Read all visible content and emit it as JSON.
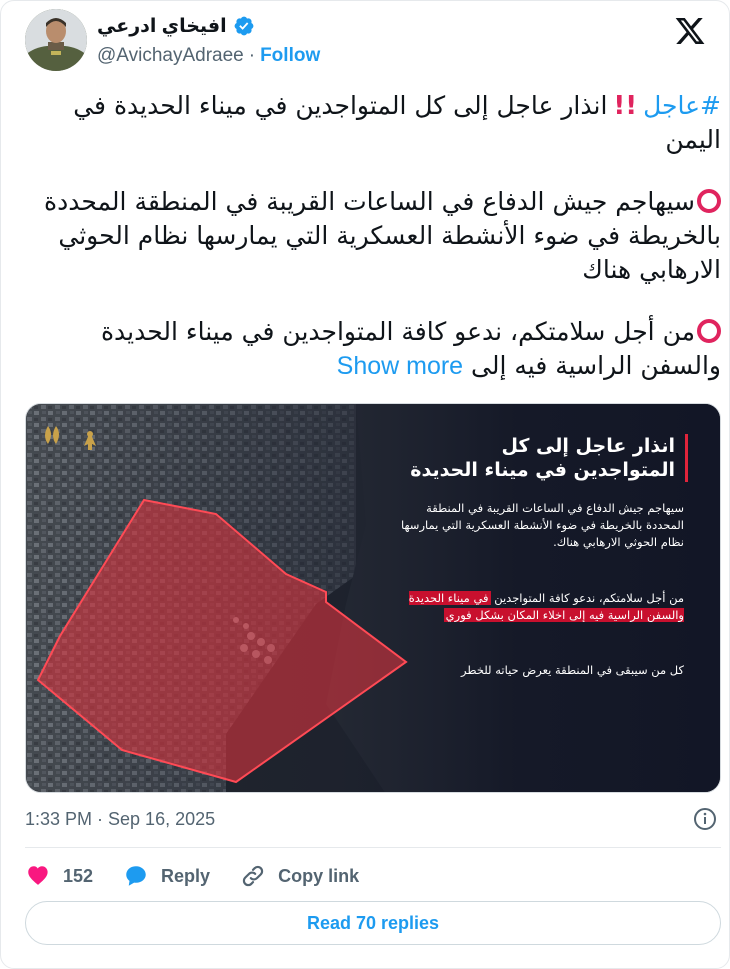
{
  "author": {
    "display_name": "افيخاي ادرعي",
    "handle": "@AvichayAdraee",
    "separator": "·",
    "follow_label": "Follow"
  },
  "tweet": {
    "hashtag": "#عاجل",
    "line1_rest": "انذار عاجل إلى كل المتواجدين في ميناء الحديدة في اليمن",
    "para2": "سيهاجم جيش الدفاع في الساعات القريبة في المنطقة المحددة بالخريطة في ضوء الأنشطة العسكرية التي يمارسها نظام الحوثي الارهابي هناك",
    "para3": "من أجل سلامتكم، ندعو كافة المتواجدين في ميناء الحديدة والسفن الراسية فيه إلى",
    "show_more": "Show more"
  },
  "media": {
    "title": "انذار عاجل إلى كل المتواجدين في ميناء الحديدة",
    "p1": "سيهاجم جيش الدفاع في الساعات القريبة في المنطقة المحددة بالخريطة في ضوء الأنشطة العسكرية التي يمارسها نظام الحوثي الارهابي هناك.",
    "p2_plain": "من أجل سلامتكم، ندعو كافة المتواجدين",
    "p2_highlight": "في ميناء الحديدة والسفن الراسية فيه إلى اخلاء المكان بشكل فوري",
    "p3": "كل من سيبقى في المنطقة يعرض حياته للخطر",
    "zone_color": "#d8343d",
    "highlight_color": "#c8102e"
  },
  "meta": {
    "timestamp": "1:33 PM · Sep 16, 2025"
  },
  "actions": {
    "like_count": "152",
    "reply_label": "Reply",
    "copy_label": "Copy link",
    "heart_color": "#f91880",
    "reply_color": "#1d9bf0"
  },
  "footer": {
    "read_replies": "Read 70 replies"
  },
  "colors": {
    "accent": "#1d9bf0",
    "text": "#0f1419",
    "muted": "#536471"
  }
}
